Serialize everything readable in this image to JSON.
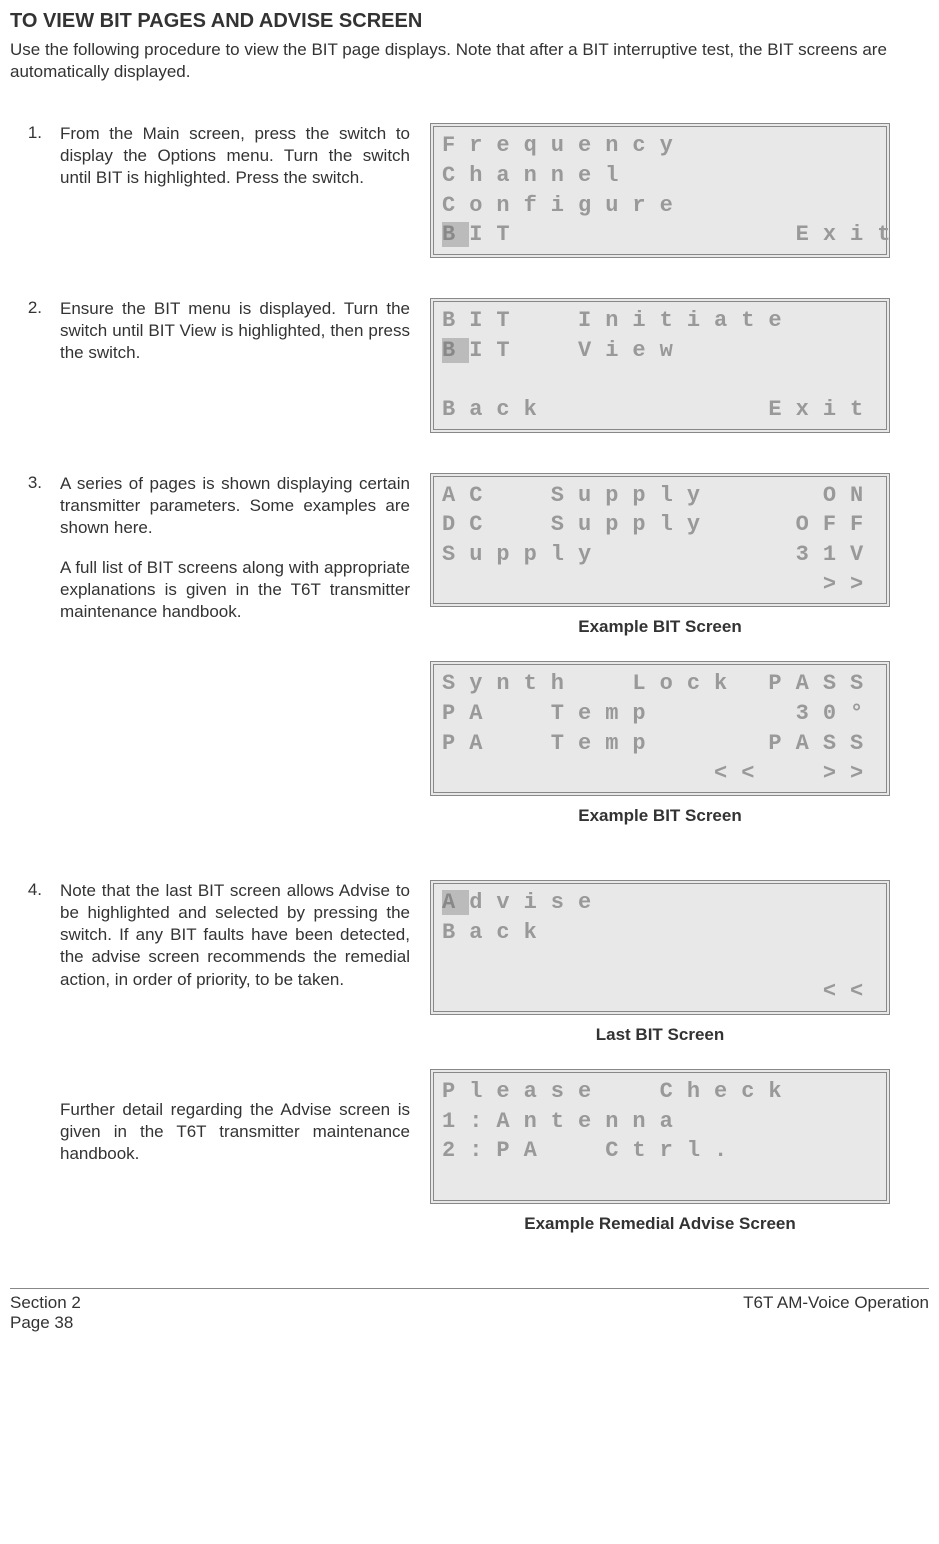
{
  "title": "TO VIEW BIT PAGES AND ADVISE SCREEN",
  "intro": "Use the following procedure to view the BIT page displays. Note that after a BIT interruptive test, the BIT screens are automatically displayed.",
  "steps": {
    "s1": {
      "num": "1.",
      "text": "From the Main screen, press the switch to display the Options menu. Turn the switch until BIT is highlighted. Press the switch."
    },
    "s2": {
      "num": "2.",
      "text": "Ensure the BIT menu is displayed. Turn the switch until BIT View is highlighted, then press the switch."
    },
    "s3": {
      "num": "3.",
      "text_a": "A series of pages is shown displaying certain transmitter parameters. Some examples are shown here.",
      "text_b": "A full list of BIT screens along with appropriate explanations is given in the T6T transmitter maintenance handbook."
    },
    "s4": {
      "num": "4.",
      "text_a": "Note that the last BIT screen allows Advise to be highlighted and selected by pressing the switch. If any BIT faults have been detected, the advise screen recommends the remedial action, in order of priority, to be taken.",
      "text_b": "Further detail regarding the Advise screen is given in the T6T transmitter maintenance handbook."
    }
  },
  "screens": {
    "options": {
      "r1": "Frequency",
      "r2": "Channel",
      "r3": "Configure",
      "r4_hl": "B",
      "r4_rest": "IT          Exit"
    },
    "bitmenu": {
      "r1": "BIT  Initiate",
      "r2_hl": "B",
      "r2_rest": "IT  View",
      "r3": "",
      "r4": "Back        Exit"
    },
    "bit1": {
      "r1": "AC  Supply    ON",
      "r2": "DC  Supply   OFF",
      "r3": "Supply       31V",
      "r4": "              >>"
    },
    "bit2": {
      "r1": "Synth  Lock PASS",
      "r2": "PA  Temp     30°",
      "r3": "PA  Temp    PASS",
      "r4": "          <<  >>"
    },
    "last": {
      "r1_hl": "A",
      "r1_rest": "dvise",
      "r2": "Back",
      "r3": "",
      "r4": "              <<"
    },
    "remedial": {
      "r1": "Please  Check",
      "r2": "1:Antenna",
      "r3": "2:PA  Ctrl.",
      "r4": ""
    }
  },
  "captions": {
    "example_bit": "Example BIT Screen",
    "last_bit": "Last BIT Screen",
    "remedial": "Example Remedial Advise Screen"
  },
  "footer": {
    "left1": "Section 2",
    "left2": "Page 38",
    "right": "T6T AM-Voice Operation"
  }
}
